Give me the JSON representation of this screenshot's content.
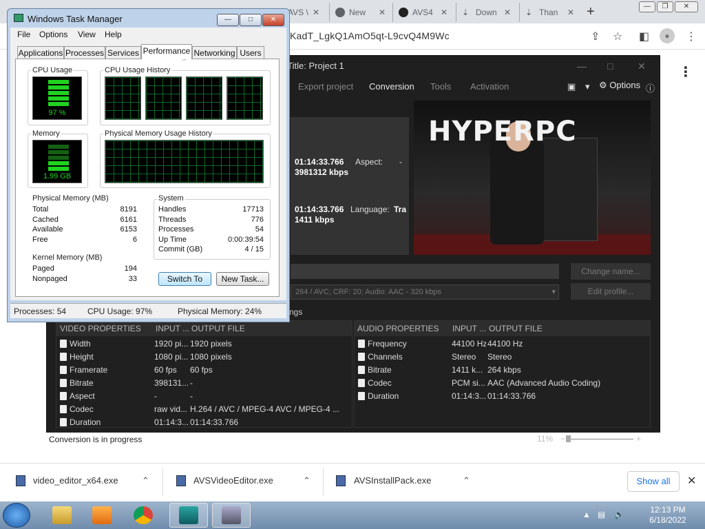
{
  "browser": {
    "tabs": [
      {
        "label": "AVS \\"
      },
      {
        "label": "New"
      },
      {
        "label": "AVS4"
      },
      {
        "label": "Down"
      },
      {
        "label": "Than"
      }
    ],
    "url_partial": "KadT_LgkQ1AmO5qt-L9cvQ4M9Wc"
  },
  "avs": {
    "title": "3% Title: Project 1",
    "menu": [
      "Export project",
      "Conversion",
      "Tools",
      "Activation"
    ],
    "options_label": "Options",
    "stream1": {
      "time": "01:14:33.766",
      "rate": "3981312 kbps",
      "label": "Aspect:",
      "value": "-"
    },
    "stream2": {
      "time": "01:14:33.766",
      "rate": "1411 kbps",
      "label": "Language:",
      "value": "Tra"
    },
    "profile_text": "264 / AVC; CRF: 20; Audio: AAC - 320 kbps",
    "change_name_label": "Change name...",
    "edit_profile_label": "Edit profile...",
    "settings_tab_partial": "ngs",
    "preview_brand": "HYPERPC",
    "video_props": {
      "headers": [
        "VIDEO PROPERTIES",
        "INPUT ...",
        "OUTPUT FILE"
      ],
      "rows": [
        [
          "Width",
          "1920 pi...",
          "1920 pixels"
        ],
        [
          "Height",
          "1080 pi...",
          "1080 pixels"
        ],
        [
          "Framerate",
          "60 fps",
          "60 fps"
        ],
        [
          "Bitrate",
          "398131...",
          "-"
        ],
        [
          "Aspect",
          "-",
          "-"
        ],
        [
          "Codec",
          "raw vid...",
          "H.264 / AVC / MPEG-4 AVC / MPEG-4 ..."
        ],
        [
          "Duration",
          "01:14:3...",
          "01:14:33.766"
        ]
      ]
    },
    "audio_props": {
      "headers": [
        "AUDIO PROPERTIES",
        "INPUT ...",
        "OUTPUT FILE"
      ],
      "rows": [
        [
          "Frequency",
          "44100 Hz",
          "44100 Hz"
        ],
        [
          "Channels",
          "Stereo",
          "Stereo"
        ],
        [
          "Bitrate",
          "1411 k...",
          "264 kbps"
        ],
        [
          "Codec",
          "PCM si...",
          "AAC (Advanced Audio Coding)"
        ],
        [
          "Duration",
          "01:14:3...",
          "01:14:33.766"
        ]
      ]
    },
    "status": "Conversion is in progress",
    "zoom": "11%"
  },
  "taskmgr": {
    "title": "Windows Task Manager",
    "menu": [
      "File",
      "Options",
      "View",
      "Help"
    ],
    "tabs": [
      "Applications",
      "Processes",
      "Services",
      "Performance",
      "Networking",
      "Users"
    ],
    "active_tab": "Performance",
    "cpu_usage_title": "CPU Usage",
    "cpu_usage_value": "97 %",
    "cpu_history_title": "CPU Usage History",
    "memory_title": "Memory",
    "memory_value": "1.99 GB",
    "phys_history_title": "Physical Memory Usage History",
    "physical_memory": {
      "title": "Physical Memory (MB)",
      "rows": [
        [
          "Total",
          "8191"
        ],
        [
          "Cached",
          "6161"
        ],
        [
          "Available",
          "6153"
        ],
        [
          "Free",
          "6"
        ]
      ]
    },
    "system": {
      "title": "System",
      "rows": [
        [
          "Handles",
          "17713"
        ],
        [
          "Threads",
          "776"
        ],
        [
          "Processes",
          "54"
        ],
        [
          "Up Time",
          "0:00:39:54"
        ],
        [
          "Commit (GB)",
          "4 / 15"
        ]
      ]
    },
    "kernel_memory": {
      "title": "Kernel Memory (MB)",
      "rows": [
        [
          "Paged",
          "194"
        ],
        [
          "Nonpaged",
          "33"
        ]
      ]
    },
    "switch_to_label": "Switch To",
    "new_task_label": "New Task...",
    "status": {
      "processes": "Processes: 54",
      "cpu": "CPU Usage: 97%",
      "memory": "Physical Memory: 24%"
    }
  },
  "downloads": {
    "items": [
      {
        "name": "video_editor_x64.exe"
      },
      {
        "name": "AVSVideoEditor.exe"
      },
      {
        "name": "AVSInstallPack.exe"
      }
    ],
    "show_all_label": "Show all"
  },
  "taskbar": {
    "time": "12:13 PM",
    "date": "6/18/2022"
  },
  "colors": {
    "avs_bg": "#1f1f1f",
    "meter_green": "#1fd31f",
    "chrome_blue": "#1a73e8",
    "taskbar": "#7f9aba"
  }
}
